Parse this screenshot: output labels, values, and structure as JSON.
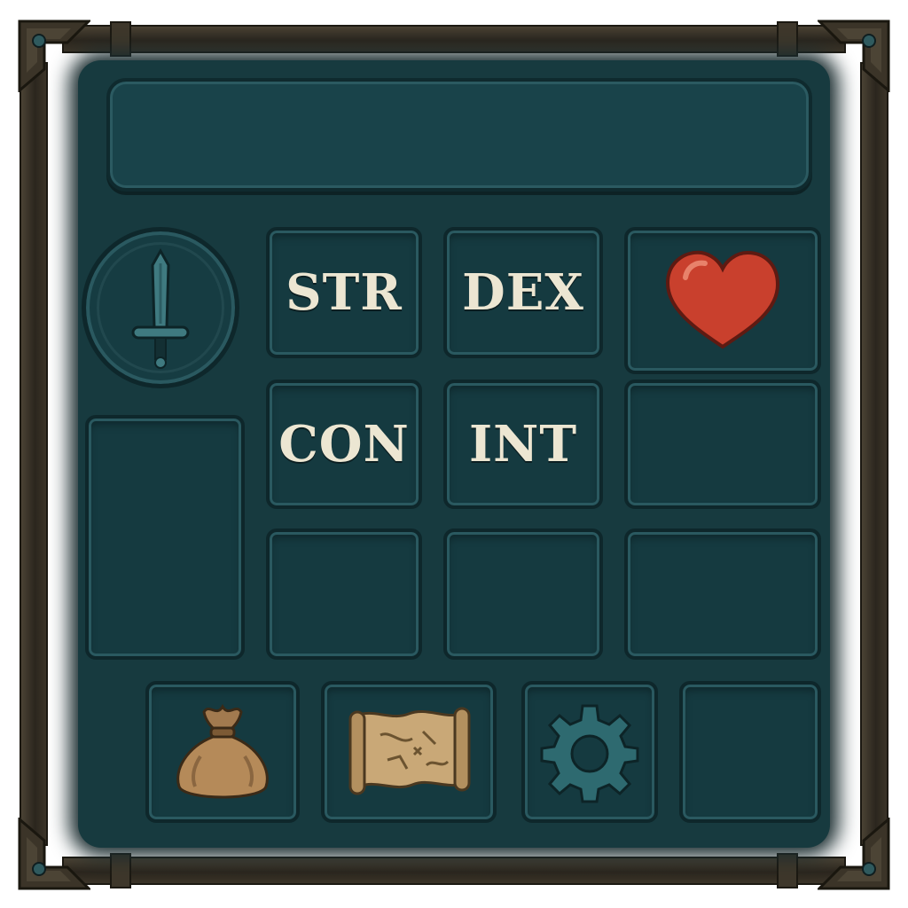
{
  "stats": {
    "str_label": "STR",
    "dex_label": "DEX",
    "con_label": "CON",
    "int_label": "INT"
  },
  "icons": {
    "equipped": "sword-icon",
    "health": "heart-icon",
    "inventory": "coin-bag-icon",
    "map": "map-scroll-icon",
    "settings": "gear-icon"
  },
  "colors": {
    "panel": "#173a3f",
    "slot": "#153a40",
    "slot_border": "#2a5960",
    "frame": "#2b261e",
    "text": "#ece6d2",
    "heart": "#c9402d",
    "parchment": "#b89564"
  }
}
